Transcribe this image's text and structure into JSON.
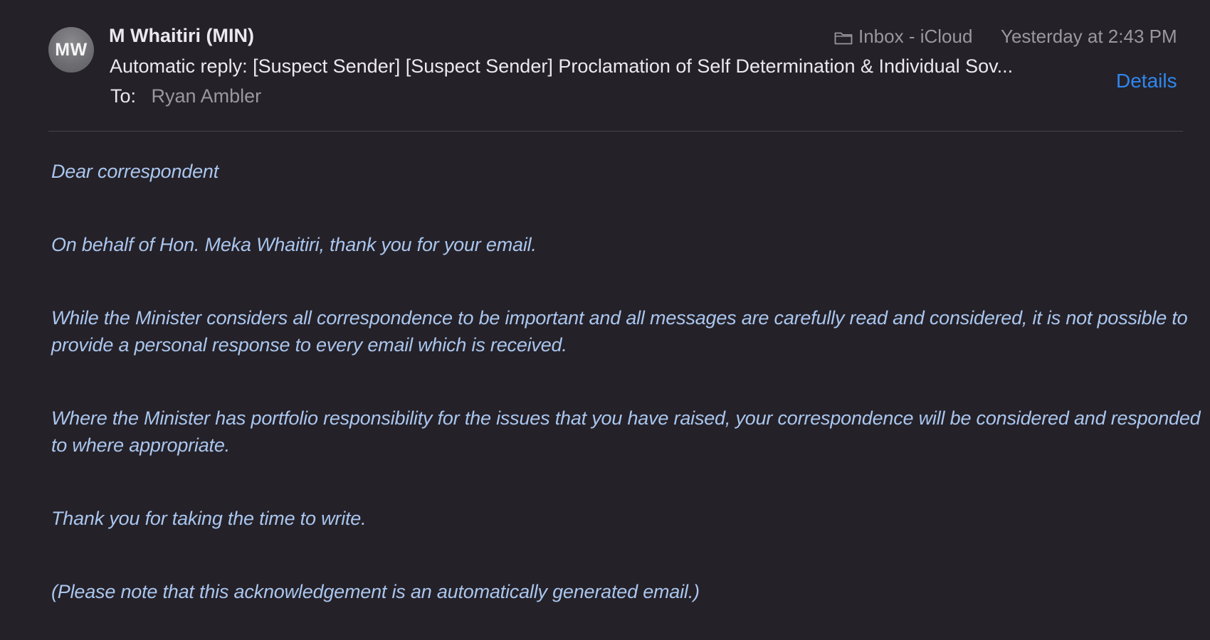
{
  "message": {
    "sender_initials": "MW",
    "sender_name": "M Whaitiri (MIN)",
    "subject": "Automatic reply: [Suspect Sender] [Suspect Sender] Proclamation of Self Determination & Individual Sov...",
    "to_label": "To:",
    "to_value": "Ryan Ambler",
    "mailbox": "Inbox - iCloud",
    "date": "Yesterday at 2:43 PM",
    "details_label": "Details",
    "mailbox_icon": "folder-icon",
    "link_color": "#2e87ef",
    "body_text_color": "#a9c6ee"
  },
  "body": {
    "paragraphs": [
      "Dear correspondent",
      "On behalf of Hon. Meka Whaitiri, thank you for your email.",
      "While the Minister considers all correspondence to be important and all messages are carefully read and considered, it is not possible to provide a personal response to every email which is received.",
      "Where the Minister has portfolio responsibility for the issues that you have raised, your correspondence will be considered and responded to where appropriate.",
      "Thank you for taking the time to write.",
      "(Please note that this acknowledgement is an automatically generated email.)"
    ]
  }
}
